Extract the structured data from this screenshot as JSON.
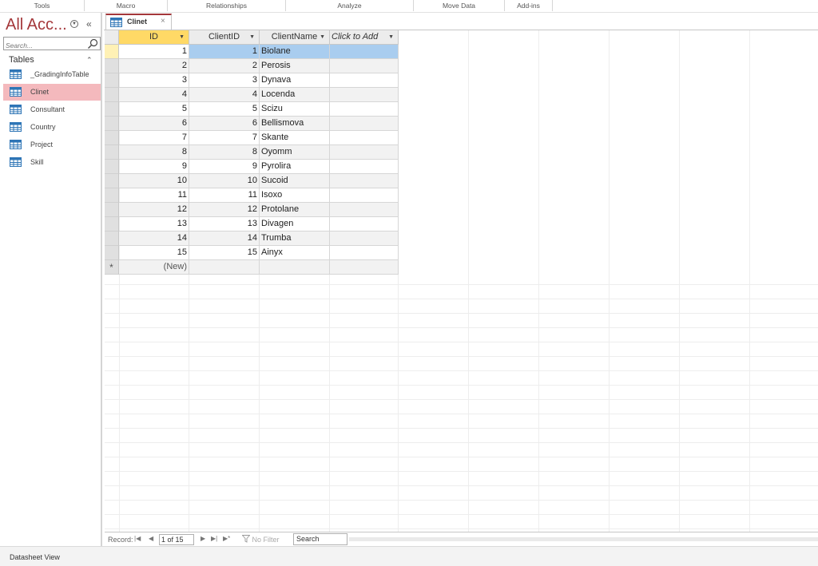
{
  "ribbon": {
    "groups": [
      "Tools",
      "Macro",
      "Relationships",
      "Analyze",
      "Move Data",
      "Add-ins"
    ]
  },
  "nav": {
    "title": "All Acc...",
    "search_placeholder": "Search...",
    "group_label": "Tables",
    "items": [
      {
        "label": "_GradingInfoTable",
        "selected": false
      },
      {
        "label": "Clinet",
        "selected": true
      },
      {
        "label": "Consultant",
        "selected": false
      },
      {
        "label": "Country",
        "selected": false
      },
      {
        "label": "Project",
        "selected": false
      },
      {
        "label": "Skill",
        "selected": false
      }
    ]
  },
  "doc_tab": {
    "label": "Clinet",
    "close_glyph": "×"
  },
  "table": {
    "columns": [
      "ID",
      "ClientID",
      "ClientName",
      "Click to Add"
    ],
    "rows": [
      {
        "id": "1",
        "client_id": "1",
        "client_name": "Biolane"
      },
      {
        "id": "2",
        "client_id": "2",
        "client_name": "Perosis"
      },
      {
        "id": "3",
        "client_id": "3",
        "client_name": "Dynava"
      },
      {
        "id": "4",
        "client_id": "4",
        "client_name": "Locenda"
      },
      {
        "id": "5",
        "client_id": "5",
        "client_name": "Scizu"
      },
      {
        "id": "6",
        "client_id": "6",
        "client_name": "Bellismova"
      },
      {
        "id": "7",
        "client_id": "7",
        "client_name": "Skante"
      },
      {
        "id": "8",
        "client_id": "8",
        "client_name": "Oyomm"
      },
      {
        "id": "9",
        "client_id": "9",
        "client_name": "Pyrolira"
      },
      {
        "id": "10",
        "client_id": "10",
        "client_name": "Sucoid"
      },
      {
        "id": "11",
        "client_id": "11",
        "client_name": "Isoxo"
      },
      {
        "id": "12",
        "client_id": "12",
        "client_name": "Protolane"
      },
      {
        "id": "13",
        "client_id": "13",
        "client_name": "Divagen"
      },
      {
        "id": "14",
        "client_id": "14",
        "client_name": "Trumba"
      },
      {
        "id": "15",
        "client_id": "15",
        "client_name": "Ainyx"
      }
    ],
    "new_row_marker": "*",
    "new_row_label": "(New)",
    "current_row_index": 0
  },
  "record_nav": {
    "label": "Record:",
    "first": "|◀",
    "prev": "◀",
    "current": "1 of 15",
    "next": "▶",
    "last": "▶|",
    "new": "▶*",
    "filter_label": "No Filter",
    "search_label": "Search"
  },
  "status": {
    "view": "Datasheet View"
  },
  "colors": {
    "accent": "#a4373a",
    "selected_nav": "#f4b9bd",
    "id_header": "#ffd966",
    "selected_cells": "#a9cdef"
  }
}
